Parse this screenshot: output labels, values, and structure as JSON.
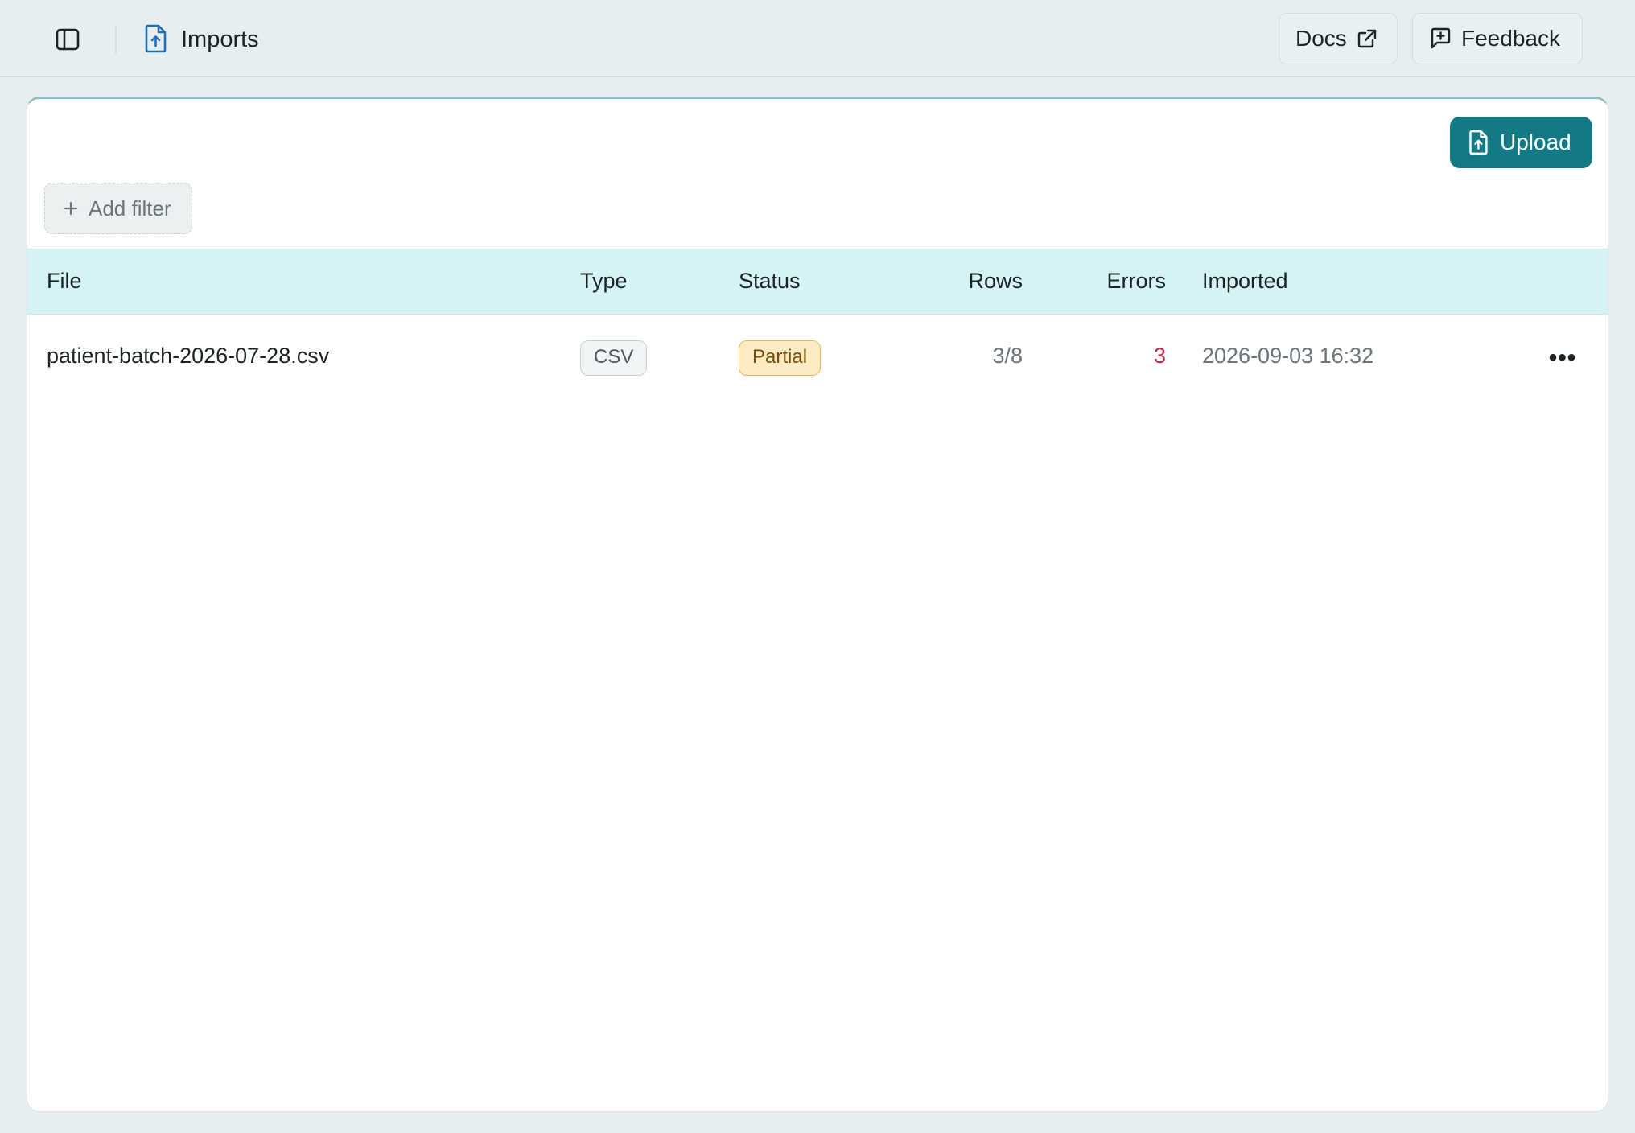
{
  "header": {
    "title": "Imports",
    "docs_label": "Docs",
    "feedback_label": "Feedback"
  },
  "toolbar": {
    "upload_label": "Upload",
    "add_filter_label": "Add filter"
  },
  "table": {
    "columns": [
      "File",
      "Type",
      "Status",
      "Rows",
      "Errors",
      "Imported"
    ],
    "rows": [
      {
        "file": "patient-batch-2026-07-28.csv",
        "type": "CSV",
        "status": "Partial",
        "rows": "3/8",
        "errors": "3",
        "imported": "2026-09-03 16:32",
        "more": "•••"
      }
    ]
  },
  "colors": {
    "accent": "#137a85",
    "header_row": "#d5f3f4",
    "error": "#c52a4a",
    "partial_bg": "#fcebc4"
  },
  "icons": [
    "sidebar-toggle-icon",
    "file-upload-icon",
    "external-link-icon",
    "message-plus-icon",
    "plus-icon",
    "more-horizontal-icon"
  ]
}
